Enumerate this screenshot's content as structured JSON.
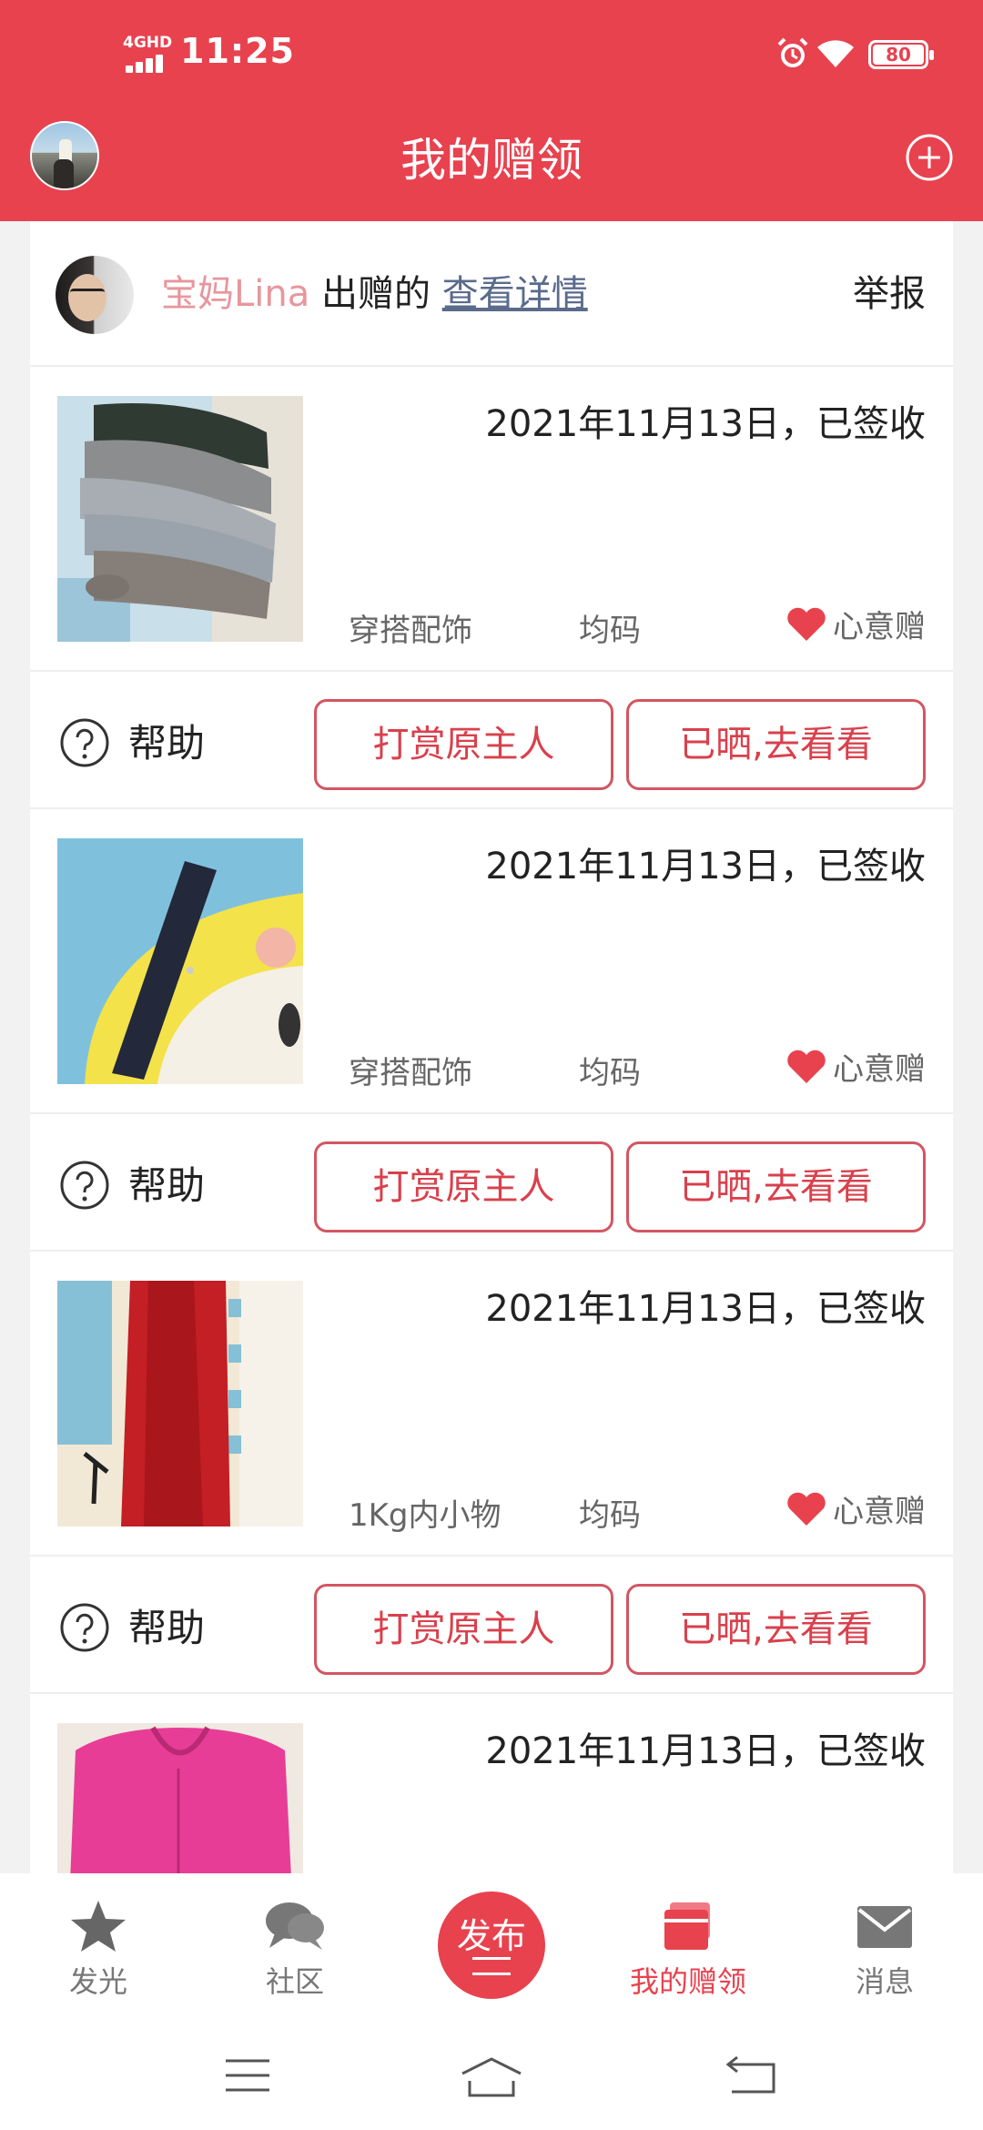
{
  "status_bar": {
    "network": "4GHD",
    "time": "11:25",
    "battery": "80"
  },
  "header": {
    "title": "我的赠领",
    "avatar_icon": "profile-avatar",
    "add_icon": "plus-circle-icon"
  },
  "giver": {
    "name": "宝妈Lina",
    "suffix": " 出赠的 ",
    "link": "查看详情",
    "report": "举报"
  },
  "items": [
    {
      "date": "2021年11月13日，已签收",
      "category": "穿搭配饰",
      "size": "均码",
      "tag": "心意赠",
      "help": "帮助",
      "reward": "打赏原主人",
      "shared": "已晒,去看看",
      "image": "grey-socks-photo"
    },
    {
      "date": "2021年11月13日，已签收",
      "category": "穿搭配饰",
      "size": "均码",
      "tag": "心意赠",
      "help": "帮助",
      "reward": "打赏原主人",
      "shared": "已晒,去看看",
      "image": "navy-headband-photo"
    },
    {
      "date": "2021年11月13日，已签收",
      "category": "1Kg内小物",
      "size": "均码",
      "tag": "心意赠",
      "help": "帮助",
      "reward": "打赏原主人",
      "shared": "已晒,去看看",
      "image": "red-resistance-band-photo"
    },
    {
      "date": "2021年11月13日，已签收",
      "image": "pink-jacket-photo"
    }
  ],
  "tabs": [
    {
      "label": "发光",
      "icon": "star-icon"
    },
    {
      "label": "社区",
      "icon": "chat-bubbles-icon"
    },
    {
      "label": "发布",
      "icon": "publish-icon"
    },
    {
      "label": "我的赠领",
      "icon": "gift-book-icon"
    },
    {
      "label": "消息",
      "icon": "envelope-icon"
    }
  ],
  "colors": {
    "brand": "#e8424f",
    "button_border": "#d25661",
    "giver_name": "#e8969d",
    "link": "#5a6b8c"
  }
}
